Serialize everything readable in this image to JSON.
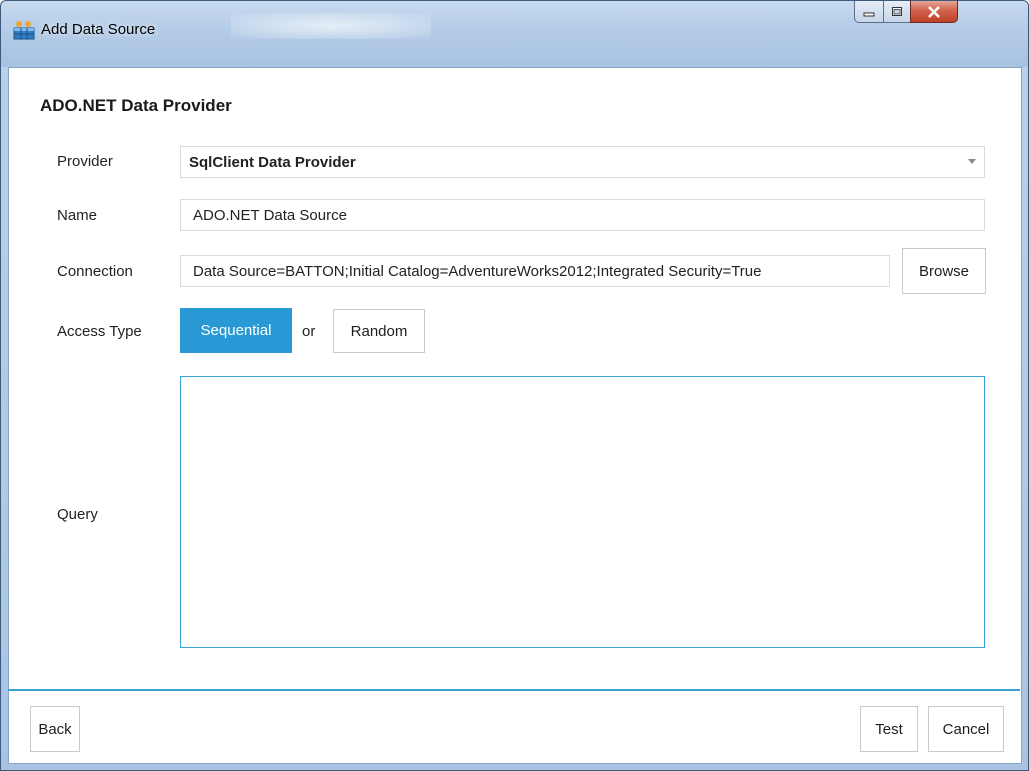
{
  "window": {
    "title": "Add Data Source",
    "icon": "database-table-icon",
    "controls": [
      "minimize-icon",
      "maximize-icon",
      "close-icon"
    ]
  },
  "heading": "ADO.NET Data Provider",
  "form": {
    "provider_label": "Provider",
    "provider_value": "SqlClient Data Provider",
    "name_label": "Name",
    "name_value": "ADO.NET Data Source",
    "connection_label": "Connection",
    "connection_value": "Data Source=BATTON;Initial Catalog=AdventureWorks2012;Integrated Security=True",
    "browse_label": "Browse",
    "access_type_label": "Access Type",
    "access_options": {
      "sequential": "Sequential",
      "or": "or",
      "random": "Random",
      "selected": "Sequential"
    },
    "query_label": "Query",
    "query_value": ""
  },
  "footer": {
    "back_label": "Back",
    "test_label": "Test",
    "cancel_label": "Cancel"
  },
  "colors": {
    "accent": "#2899d4",
    "query_border": "#3aa1d4",
    "close_button": "#c94a33"
  }
}
